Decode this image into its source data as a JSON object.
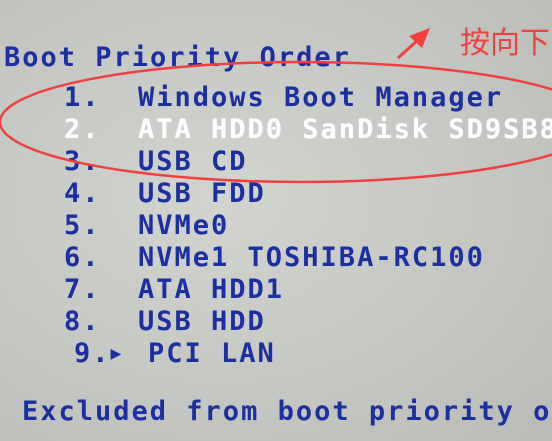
{
  "annotation": {
    "text": "按向下",
    "color": "#f04040"
  },
  "title": "Boot Priority Order",
  "items": [
    {
      "num": "1.",
      "label": "Windows Boot Manager",
      "highlighted": false
    },
    {
      "num": "2.",
      "label": "ATA HDD0 SanDisk SD9SB8",
      "highlighted": true
    },
    {
      "num": "3.",
      "label": "USB CD",
      "highlighted": false
    },
    {
      "num": "4.",
      "label": "USB FDD",
      "highlighted": false
    },
    {
      "num": "5.",
      "label": "NVMe0",
      "highlighted": false
    },
    {
      "num": "6.",
      "label": "NVMe1 TOSHIBA-RC100",
      "highlighted": false
    },
    {
      "num": "7.",
      "label": "ATA HDD1",
      "highlighted": false
    },
    {
      "num": "8.",
      "label": "USB HDD",
      "highlighted": false
    },
    {
      "num": "9.",
      "marker": "▶",
      "label": "PCI LAN",
      "highlighted": false
    }
  ],
  "footer": "Excluded from boot priority or",
  "colors": {
    "text": "#1c2fa0",
    "highlight": "#ffffff",
    "annotation": "#f04040"
  }
}
